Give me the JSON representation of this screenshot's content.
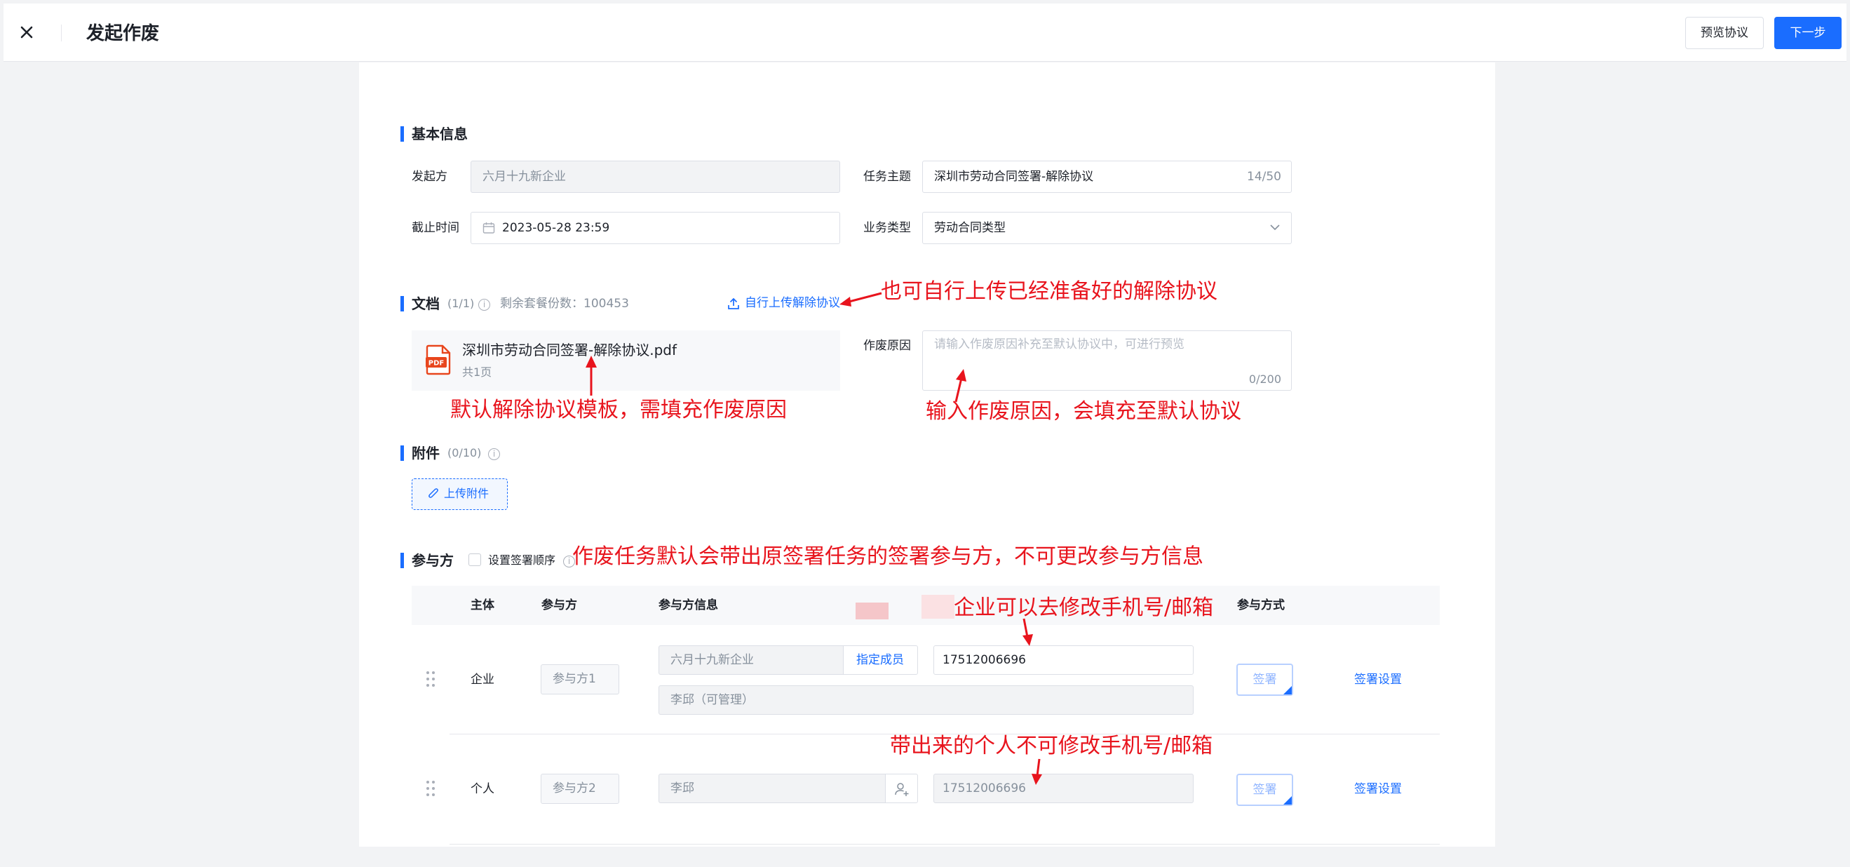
{
  "header": {
    "title": "发起作废",
    "preview_label": "预览协议",
    "next_label": "下一步"
  },
  "basic_info": {
    "section_title": "基本信息",
    "initiator_label": "发起方",
    "initiator_value": "六月十九新企业",
    "subject_label": "任务主题",
    "subject_value": "深圳市劳动合同签署-解除协议",
    "subject_count": "14/50",
    "deadline_label": "截止时间",
    "deadline_value": "2023-05-28 23:59",
    "biz_type_label": "业务类型",
    "biz_type_value": "劳动合同类型"
  },
  "documents": {
    "section_title": "文档",
    "count": "(1/1)",
    "remaining_label": "剩余套餐份数：100453",
    "upload_link": "自行上传解除协议",
    "file_name": "深圳市劳动合同签署-解除协议.pdf",
    "file_pages": "共1页",
    "file_icon_text": "PDF",
    "reason_label": "作废原因",
    "reason_placeholder": "请输入作废原因补充至默认协议中，可进行预览",
    "reason_count": "0/200"
  },
  "attachments": {
    "section_title": "附件",
    "count": "(0/10)",
    "upload_button": "上传附件"
  },
  "participants": {
    "section_title": "参与方",
    "order_checkbox_label": "设置签署顺序",
    "columns": {
      "subject": "主体",
      "party": "参与方",
      "party_info": "参与方信息",
      "sign_mode": "参与方式"
    },
    "rows": [
      {
        "subject": "企业",
        "party_placeholder": "参与方1",
        "company": "六月十九新企业",
        "assign_member": "指定成员",
        "contact": "17512006696",
        "member": "李邱（可管理）",
        "sign_button": "签署",
        "sign_settings": "签署设置"
      },
      {
        "subject": "个人",
        "party_placeholder": "参与方2",
        "name": "李邱",
        "contact": "17512006696",
        "sign_button": "签署",
        "sign_settings": "签署设置"
      }
    ]
  },
  "annotations": {
    "upload_note": "也可自行上传已经准备好的解除协议",
    "template_note": "默认解除协议模板，需填充作废原因",
    "reason_note": "输入作废原因，会填充至默认协议",
    "participants_note": "作废任务默认会带出原签署任务的签署参与方，不可更改参与方信息",
    "company_note": "企业可以去修改手机号/邮箱",
    "person_note": "带出来的个人不可修改手机号/邮箱"
  },
  "colors": {
    "primary": "#1a6dff",
    "annotation": "#e8141d",
    "pdf_icon": "#e8461d"
  }
}
